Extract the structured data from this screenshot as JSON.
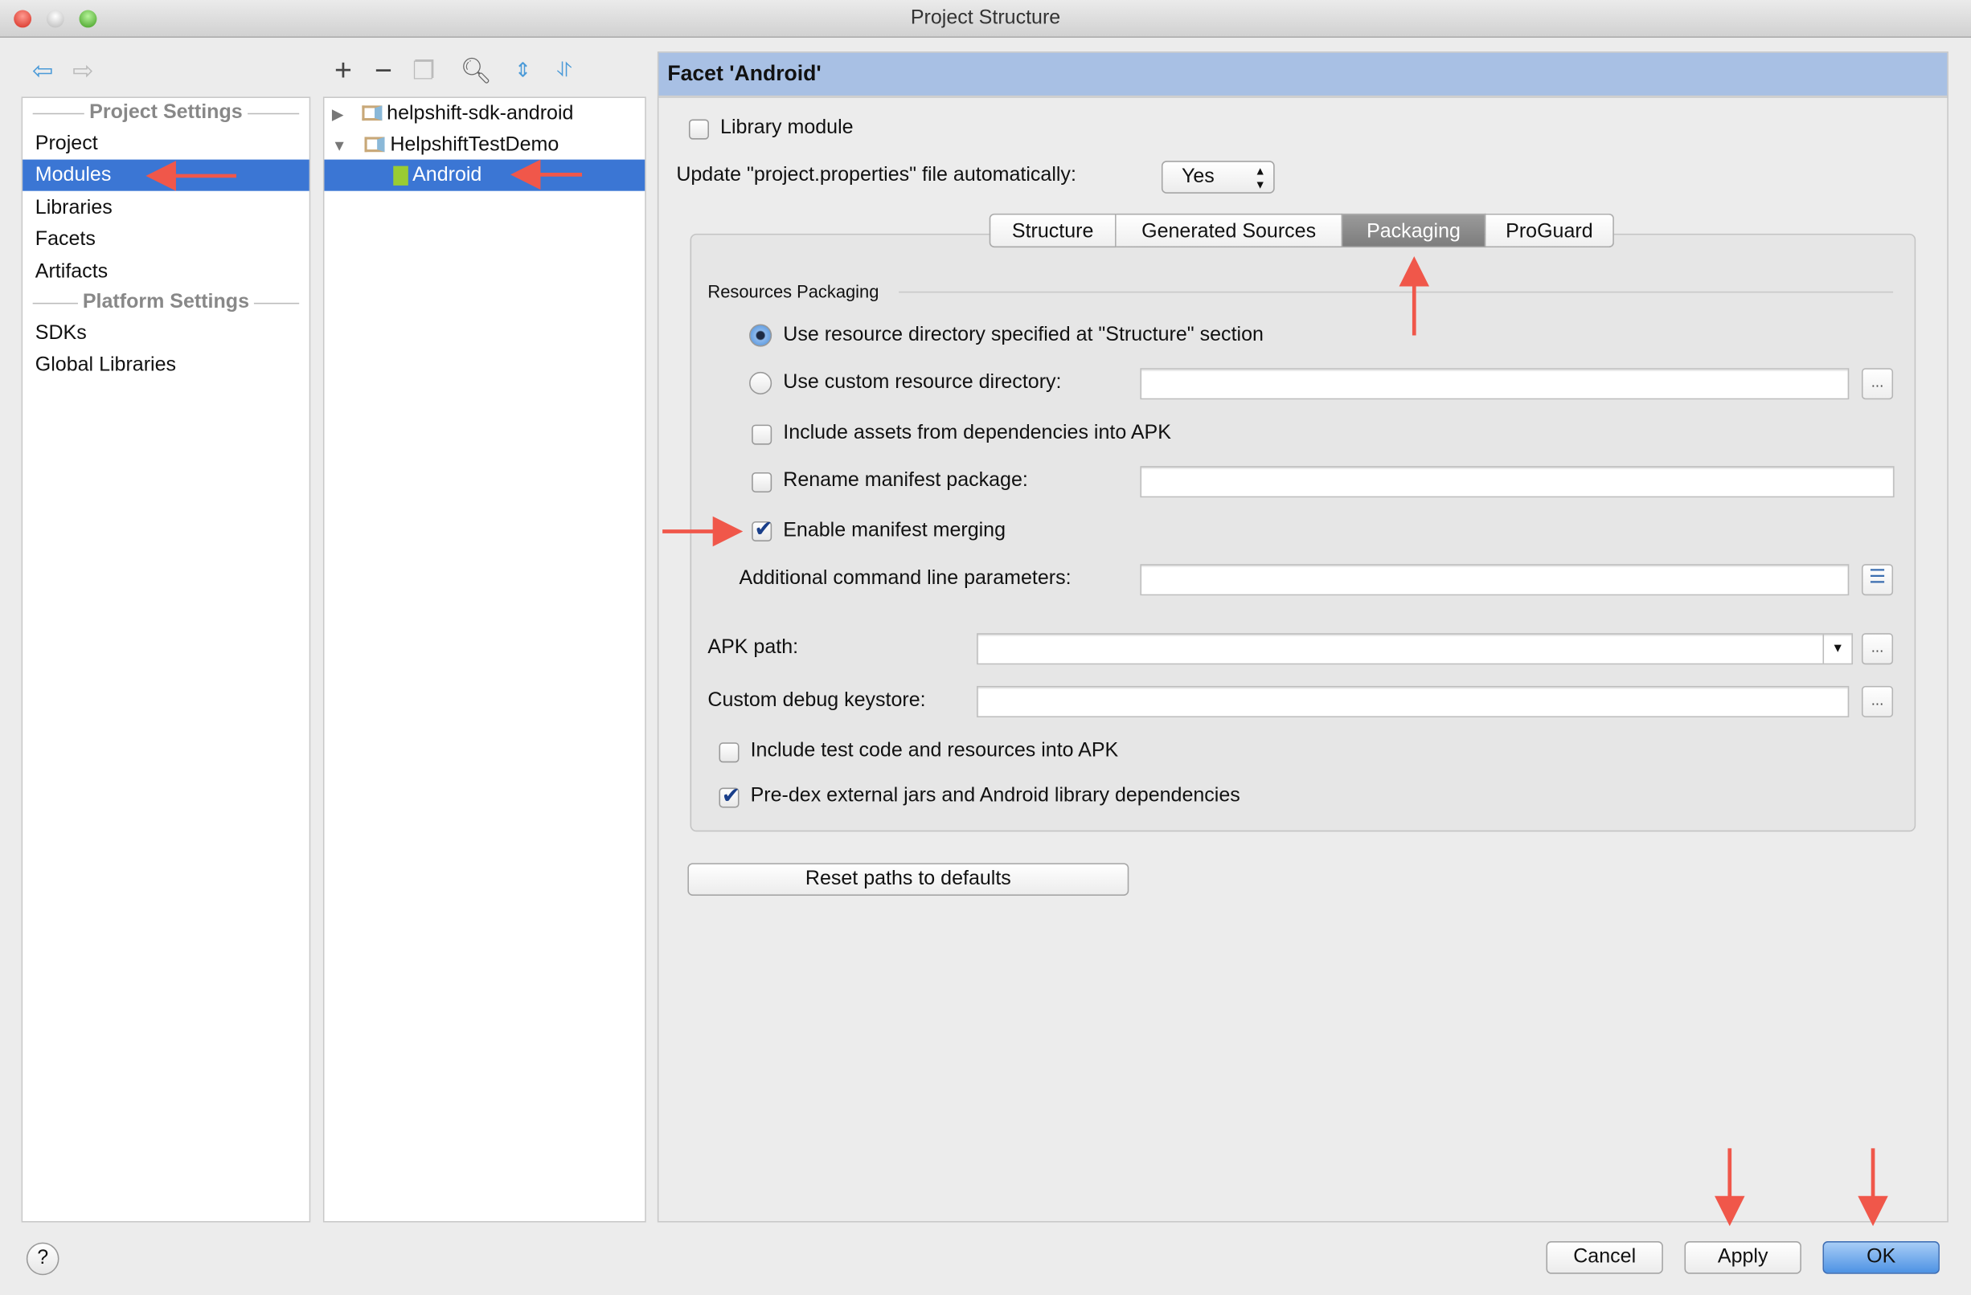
{
  "window": {
    "title": "Project Structure"
  },
  "toolbar": {
    "icons": [
      "back-arrow",
      "forward-arrow",
      "add",
      "remove",
      "copy",
      "search",
      "expand-all",
      "collapse-all"
    ]
  },
  "sidebar": {
    "project_settings_header": "Project Settings",
    "platform_settings_header": "Platform Settings",
    "items": [
      {
        "label": "Project"
      },
      {
        "label": "Modules",
        "selected": true
      },
      {
        "label": "Libraries"
      },
      {
        "label": "Facets"
      },
      {
        "label": "Artifacts"
      }
    ],
    "platform_items": [
      {
        "label": "SDKs"
      },
      {
        "label": "Global Libraries"
      }
    ]
  },
  "tree": {
    "nodes": [
      {
        "label": "helpshift-sdk-android",
        "expanded": false
      },
      {
        "label": "HelpshiftTestDemo",
        "expanded": true
      },
      {
        "label": "Android",
        "selected": true
      }
    ]
  },
  "facet": {
    "header": "Facet 'Android'",
    "library_module": {
      "label": "Library module",
      "checked": false
    },
    "update_label": "Update \"project.properties\" file automatically:",
    "update_value": "Yes",
    "tabs": [
      {
        "label": "Structure"
      },
      {
        "label": "Generated Sources"
      },
      {
        "label": "Packaging",
        "selected": true
      },
      {
        "label": "ProGuard"
      }
    ],
    "resources_packaging": "Resources Packaging",
    "radio_structure": {
      "label": "Use resource directory specified at \"Structure\" section",
      "checked": true
    },
    "radio_custom": {
      "label": "Use custom resource directory:",
      "checked": false,
      "value": ""
    },
    "include_assets": {
      "label": "Include assets from dependencies into APK",
      "checked": false
    },
    "rename_manifest": {
      "label": "Rename manifest package:",
      "checked": false,
      "value": ""
    },
    "enable_merging": {
      "label": "Enable manifest merging",
      "checked": true
    },
    "additional_params": {
      "label": "Additional command line parameters:",
      "value": ""
    },
    "apk_path": {
      "label": "APK path:",
      "value": ""
    },
    "debug_keystore": {
      "label": "Custom debug keystore:",
      "value": ""
    },
    "include_test": {
      "label": "Include test code and resources into APK",
      "checked": false
    },
    "predex": {
      "label": "Pre-dex external jars and Android library dependencies",
      "checked": true
    },
    "browse": "...",
    "reset_button": "Reset paths to defaults"
  },
  "footer": {
    "help": "?",
    "cancel": "Cancel",
    "apply": "Apply",
    "ok": "OK"
  },
  "colors": {
    "selection": "#3b76d4",
    "header": "#a8c0e4",
    "annotation_arrow": "#f0574a",
    "ok_button": "#5a9de8"
  }
}
